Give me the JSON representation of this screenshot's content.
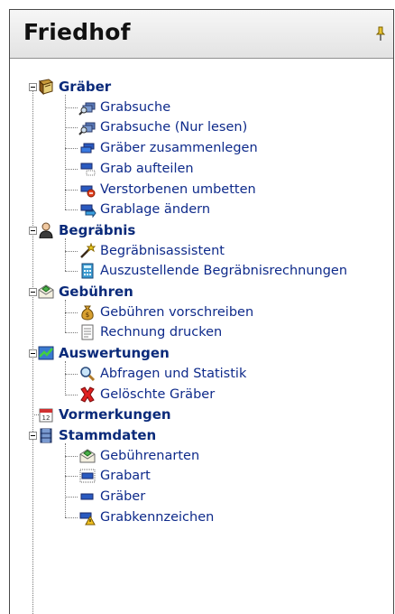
{
  "header": {
    "title": "Friedhof",
    "pin_icon": "pin-icon"
  },
  "groups": [
    {
      "label": "Gräber",
      "icon": "book-icon",
      "items": [
        {
          "label": "Grabsuche",
          "icon": "search-screens-icon"
        },
        {
          "label": "Grabsuche (Nur lesen)",
          "icon": "search-screens-icon"
        },
        {
          "label": "Gräber zusammenlegen",
          "icon": "merge-graves-icon"
        },
        {
          "label": "Grab aufteilen",
          "icon": "split-grave-icon"
        },
        {
          "label": "Verstorbenen umbetten",
          "icon": "rebury-icon"
        },
        {
          "label": "Grablage ändern",
          "icon": "move-grave-icon"
        }
      ]
    },
    {
      "label": "Begräbnis",
      "icon": "person-icon",
      "items": [
        {
          "label": "Begräbnisassistent",
          "icon": "wizard-wand-icon"
        },
        {
          "label": "Auszustellende Begräbnisrechnungen",
          "icon": "calculator-icon"
        }
      ]
    },
    {
      "label": "Gebühren",
      "icon": "envelope-icon",
      "items": [
        {
          "label": "Gebühren vorschreiben",
          "icon": "money-bag-icon"
        },
        {
          "label": "Rechnung drucken",
          "icon": "invoice-icon"
        }
      ]
    },
    {
      "label": "Auswertungen",
      "icon": "chart-icon",
      "items": [
        {
          "label": "Abfragen und Statistik",
          "icon": "magnifier-icon"
        },
        {
          "label": "Gelöschte Gräber",
          "icon": "delete-x-icon"
        }
      ]
    },
    {
      "label": "Vormerkungen",
      "icon": "calendar-icon",
      "items": []
    },
    {
      "label": "Stammdaten",
      "icon": "database-icon",
      "items": [
        {
          "label": "Gebührenarten",
          "icon": "envelope-icon"
        },
        {
          "label": "Grabart",
          "icon": "grave-type-icon"
        },
        {
          "label": "Gräber",
          "icon": "grave-icon"
        },
        {
          "label": "Grabkennzeichen",
          "icon": "grave-mark-icon"
        }
      ]
    }
  ]
}
